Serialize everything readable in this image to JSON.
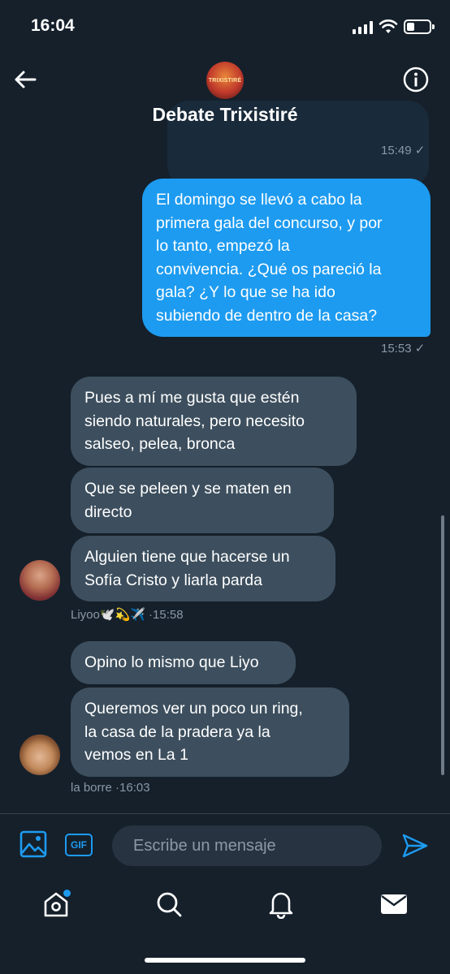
{
  "status_bar": {
    "time": "16:04",
    "battery_level": 0.35
  },
  "header": {
    "avatar_text": "TRIXISTIRÉ",
    "title": "Debate Trixistiré"
  },
  "messages": {
    "first_timestamp": "15:49 ✓",
    "outgoing": {
      "lines": [
        "El domingo se llevó a cabo la",
        "primera gala del concurso, y por",
        "lo tanto, empezó la",
        "convivencia. ¿Qué os pareció la",
        "gala? ¿Y lo que se ha ido",
        "subiendo de dentro de la casa?"
      ],
      "timestamp": "15:53 ✓"
    },
    "liyoo": {
      "bubble1": [
        "Pues a mí me gusta que estén",
        "siendo naturales, pero necesito",
        "salseo, pelea, bronca"
      ],
      "bubble2": [
        "Que se peleen y se maten en",
        "directo"
      ],
      "bubble3": [
        "Alguien tiene que hacerse un",
        "Sofía Cristo y liarla parda"
      ],
      "sender": "Liyoo🕊️💫✈️ ·15:58"
    },
    "borre": {
      "bubble1": [
        "Opino lo mismo que Liyo"
      ],
      "bubble2": [
        "Queremos ver un poco un ring,",
        "la casa de la pradera ya la",
        "vemos en La 1"
      ],
      "sender": "la borre ·16:03"
    }
  },
  "composer": {
    "gif_label": "GIF",
    "placeholder": "Escribe un mensaje"
  },
  "colors": {
    "accent": "#1d9bf0",
    "background": "#15202b",
    "incoming_bubble": "#3d4f5e"
  },
  "icons": [
    "back-arrow-icon",
    "info-icon",
    "image-icon",
    "gif-icon",
    "send-icon",
    "home-icon",
    "search-icon",
    "bell-icon",
    "mail-icon"
  ]
}
